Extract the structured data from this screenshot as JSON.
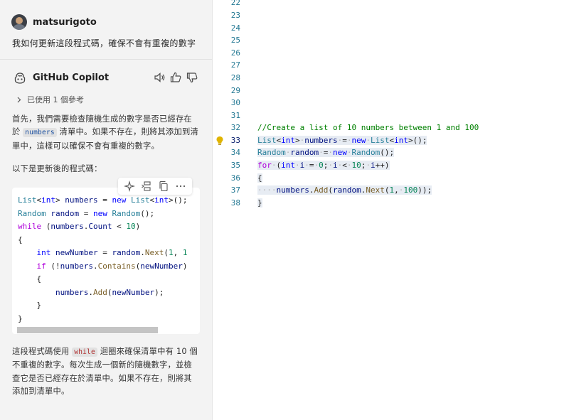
{
  "chat": {
    "user": {
      "name": "matsurigoto",
      "message": "我如何更新這段程式碼，確保不會有重複的數字"
    },
    "assistant": {
      "name": "GitHub Copilot",
      "references": "已使用 1 個參考",
      "intro_part1": "首先，我們需要檢查隨機生成的數字是否已經存在於",
      "intro_code": "numbers",
      "intro_part2": "清單中。如果不存在，則將其添加到清單中，這樣可以確保不會有重複的數字。",
      "code_intro": "以下是更新後的程式碼：",
      "code_lines": [
        "List<int> numbers = new List<int>();",
        "Random random = new Random();",
        "while (numbers.Count < 10)",
        "{",
        "    int newNumber = random.Next(1, 1",
        "    if (!numbers.Contains(newNumber)",
        "    {",
        "        numbers.Add(newNumber);",
        "    }",
        "}"
      ],
      "outro_part1": "這段程式碼使用",
      "outro_code": "while",
      "outro_part2": "迴圈來確保清單中有 10 個不重複的數字。每次生成一個新的隨機數字，並檢查它是否已經存在於清單中。如果不存在，則將其添加到清單中。"
    }
  },
  "editor": {
    "line_numbers": [
      "22",
      "23",
      "24",
      "25",
      "26",
      "27",
      "28",
      "29",
      "30",
      "31",
      "32",
      "33",
      "34",
      "35",
      "36",
      "37",
      "38"
    ],
    "active_line": "33",
    "comment": "//Create a list of 10 numbers between 1 and 100"
  },
  "icons": {
    "avatar": "user-avatar",
    "copilot": "copilot-icon",
    "speaker": "speaker-icon",
    "thumbs_up": "thumbs-up-icon",
    "thumbs_down": "thumbs-down-icon",
    "sparkle": "sparkle-icon",
    "insert": "insert-at-cursor-icon",
    "copy": "copy-icon",
    "more": "more-icon",
    "lightbulb": "lightbulb-icon"
  },
  "colors": {
    "keyword": "#0000ff",
    "control": "#af00db",
    "type": "#267f99",
    "number": "#098658",
    "comment": "#008000",
    "selection": "#e7ecf3"
  }
}
